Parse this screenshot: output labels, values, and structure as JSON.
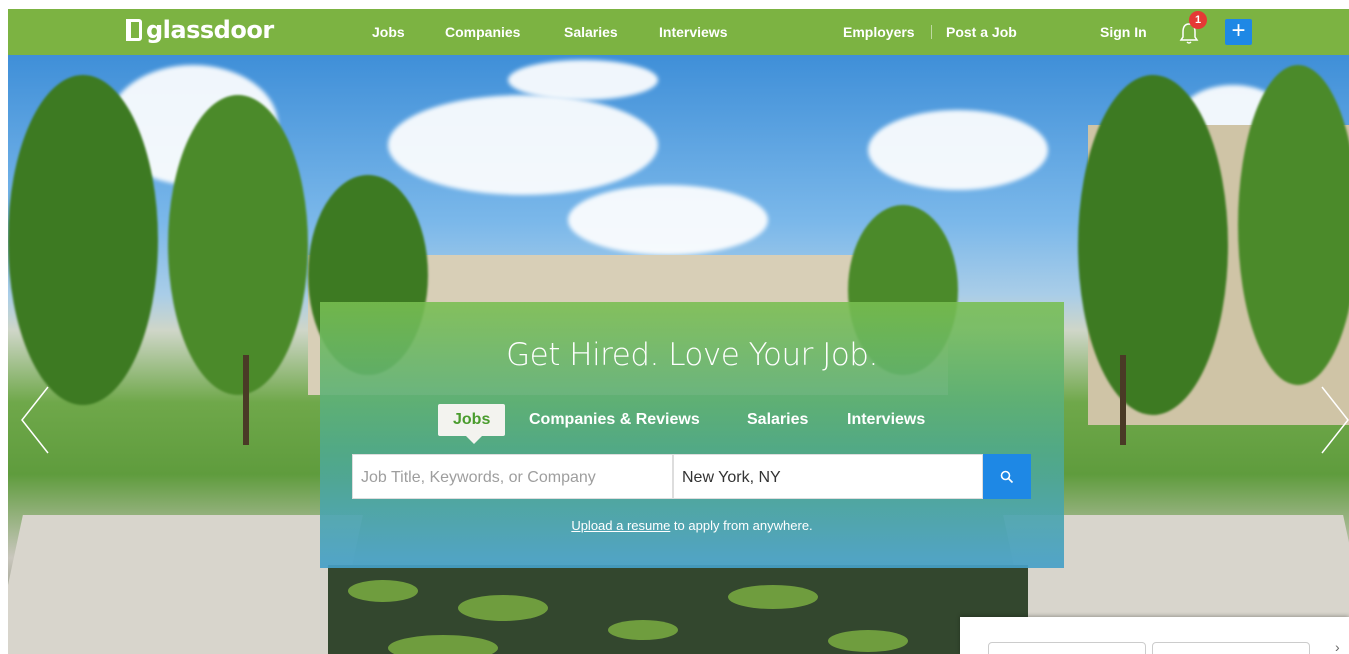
{
  "brand": {
    "logo_text": "glassdoor"
  },
  "nav": {
    "links": [
      "Jobs",
      "Companies",
      "Salaries",
      "Interviews"
    ],
    "employers": "Employers",
    "post_job": "Post a Job",
    "sign_in": "Sign In",
    "notification_count": "1",
    "plus": "+"
  },
  "hero": {
    "headline": "Get Hired. Love Your Job.",
    "tabs": [
      "Jobs",
      "Companies & Reviews",
      "Salaries",
      "Interviews"
    ],
    "active_tab": "Jobs",
    "search": {
      "keyword_placeholder": "Job Title, Keywords, or Company",
      "location_value": "New York, NY"
    },
    "upload_link": "Upload a resume",
    "upload_text": " to apply from anywhere."
  },
  "colors": {
    "nav_green": "#7cb342",
    "accent_blue": "#1e88e5",
    "badge_red": "#e53935"
  }
}
